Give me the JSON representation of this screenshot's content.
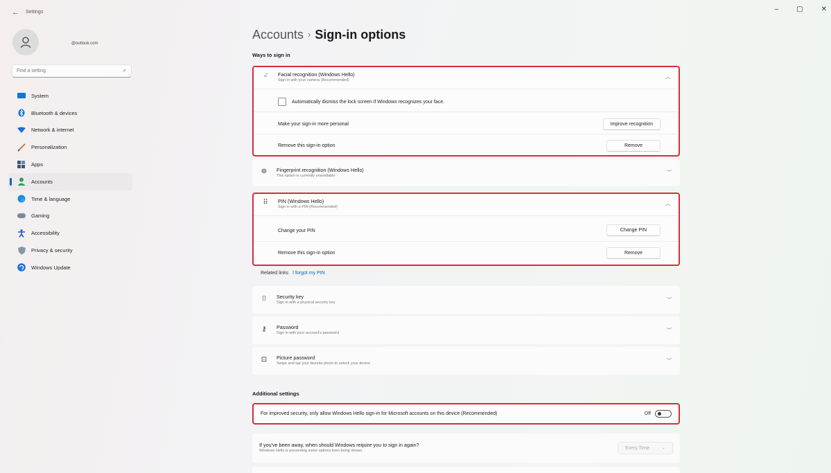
{
  "window": {
    "title": "Settings",
    "back_glyph": "←",
    "minimize_glyph": "–",
    "maximize_glyph": "▢",
    "close_glyph": "✕"
  },
  "user": {
    "email": "@outlook.com"
  },
  "search": {
    "placeholder": "Find a setting"
  },
  "nav": [
    {
      "label": "System",
      "icon": "monitor-icon",
      "color": "#0a78d4"
    },
    {
      "label": "Bluetooth & devices",
      "icon": "bluetooth-icon",
      "color": "#0a6fd1"
    },
    {
      "label": "Network & internet",
      "icon": "wifi-icon",
      "color": "#1f6ed6"
    },
    {
      "label": "Personalization",
      "icon": "brush-icon",
      "color": "#c4673b"
    },
    {
      "label": "Apps",
      "icon": "apps-icon",
      "color": "#3d5578"
    },
    {
      "label": "Accounts",
      "icon": "accounts-icon",
      "color": "#2aa15a",
      "active": true
    },
    {
      "label": "Time & language",
      "icon": "globe-clock-icon",
      "color": "#1f8ad6"
    },
    {
      "label": "Gaming",
      "icon": "gamepad-icon",
      "color": "#7a8a9a"
    },
    {
      "label": "Accessibility",
      "icon": "accessibility-icon",
      "color": "#1a5fb4"
    },
    {
      "label": "Privacy & security",
      "icon": "shield-icon",
      "color": "#7b8794"
    },
    {
      "label": "Windows Update",
      "icon": "update-icon",
      "color": "#1f6ed6"
    }
  ],
  "breadcrumb": {
    "parent": "Accounts",
    "separator": "›",
    "current": "Sign-in options"
  },
  "ways_heading": "Ways to sign in",
  "facial": {
    "title": "Facial recognition (Windows Hello)",
    "subtitle": "Sign in with your camera (Recommended)",
    "checkbox_label": "Automatically dismiss the lock screen if Windows recognizes your face.",
    "personal_label": "Make your sign-in more personal",
    "improve_button": "Improve recognition",
    "remove_label": "Remove this sign-in option",
    "remove_button": "Remove"
  },
  "fingerprint": {
    "title": "Fingerprint recognition (Windows Hello)",
    "subtitle": "This option is currently unavailable"
  },
  "pin": {
    "title": "PIN (Windows Hello)",
    "subtitle": "Sign in with a PIN (Recommended)",
    "change_label": "Change your PIN",
    "change_button": "Change PIN",
    "remove_label": "Remove this sign-in option",
    "remove_button": "Remove"
  },
  "related": {
    "label": "Related links",
    "link": "I forgot my PIN"
  },
  "security_key": {
    "title": "Security key",
    "subtitle": "Sign in with a physical security key"
  },
  "password": {
    "title": "Password",
    "subtitle": "Sign in with your account's password"
  },
  "picture_password": {
    "title": "Picture password",
    "subtitle": "Swipe and tap your favorite photo to unlock your device"
  },
  "additional_heading": "Additional settings",
  "hello_only": {
    "label": "For improved security, only allow Windows Hello sign-in for Microsoft accounts on this device (Recommended)",
    "state_label": "Off"
  },
  "require_signin": {
    "title": "If you've been away, when should Windows require you to sign in again?",
    "subtitle": "Windows Hello is preventing some options from being shown.",
    "value": "Every Time"
  },
  "glyphs": {
    "chevron_up": "︿",
    "chevron_down": "﹀",
    "dropdown_chevron": "⌄"
  },
  "colors": {
    "highlight": "#d12f3f",
    "accent": "#0067c0"
  }
}
